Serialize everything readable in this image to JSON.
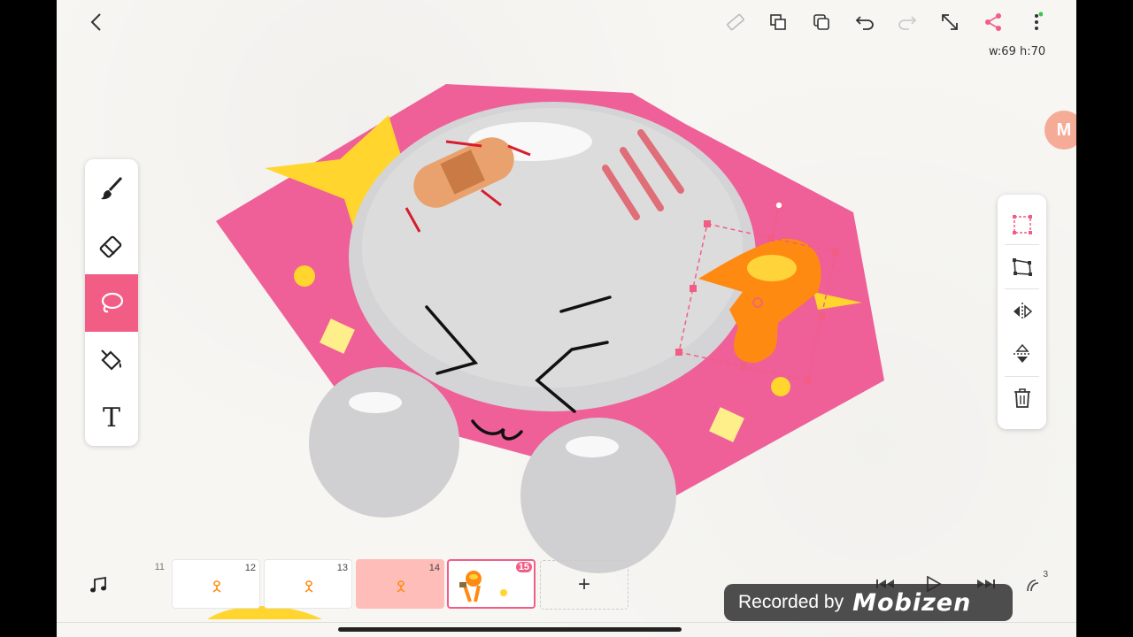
{
  "canvas": {
    "size_readout": "w:69 h:70"
  },
  "icons": {
    "back": "chevron-left-icon",
    "ruler": "ruler-icon",
    "copy_layer": "copy-icon",
    "layers": "layers-icon",
    "undo": "undo-icon",
    "redo": "redo-icon",
    "resize": "resize-icon",
    "share": "share-icon",
    "more": "more-vertical-icon"
  },
  "tools": [
    {
      "name": "brush",
      "active": false
    },
    {
      "name": "eraser",
      "active": false
    },
    {
      "name": "lasso",
      "active": true
    },
    {
      "name": "fill-bucket",
      "active": false
    },
    {
      "name": "text",
      "label": "T",
      "active": false
    }
  ],
  "transform_panel": [
    "rect-select",
    "free-transform",
    "flip-horizontal",
    "flip-vertical",
    "delete"
  ],
  "badge": {
    "letter": "M"
  },
  "timeline": {
    "frames": [
      {
        "number": "11",
        "state": "faded"
      },
      {
        "number": "12",
        "state": "normal"
      },
      {
        "number": "13",
        "state": "normal"
      },
      {
        "number": "14",
        "state": "selected"
      },
      {
        "number": "15",
        "state": "current"
      }
    ],
    "add_label": "+"
  },
  "playback": [
    "skip-back-icon",
    "play-icon",
    "skip-forward-icon",
    "onion-skin-icon"
  ],
  "onion_count": "3",
  "watermark": {
    "prefix": "Recorded by",
    "brand": "Mobizen"
  },
  "colors": {
    "accent": "#f25d86",
    "selected_frame": "#ffbdb9",
    "pink_blanket": "#ef5f98",
    "orange_sketch": "#ff8a12",
    "star_yellow": "#ffd52e"
  }
}
